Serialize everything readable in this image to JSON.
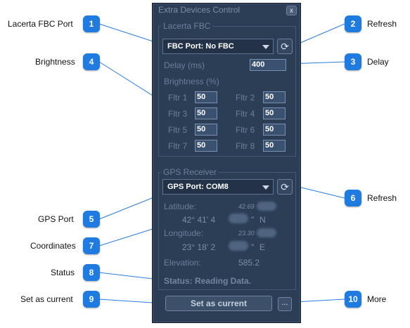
{
  "window": {
    "title": "Extra Devices Control",
    "close_label": "x"
  },
  "lacerta": {
    "group_title": "Lacerta FBC",
    "port_value": "FBC Port: No FBC",
    "delay_label": "Delay (ms)",
    "delay_value": "400",
    "brightness_label": "Brightness (%)",
    "filters": [
      {
        "label": "Fltr 1",
        "value": "50"
      },
      {
        "label": "Fltr 2",
        "value": "50"
      },
      {
        "label": "Fltr 3",
        "value": "50"
      },
      {
        "label": "Fltr 4",
        "value": "50"
      },
      {
        "label": "Fltr 5",
        "value": "50"
      },
      {
        "label": "Fltr 6",
        "value": "50"
      },
      {
        "label": "Fltr 7",
        "value": "50"
      },
      {
        "label": "Fltr 8",
        "value": "50"
      }
    ]
  },
  "gps": {
    "group_title": "GPS Receiver",
    "port_value": "GPS Port: COM8",
    "latitude_label": "Latitude:",
    "latitude_decimal": "42.69",
    "latitude_dms_deg": "42° 41' 4",
    "latitude_dms_sec_mark": "\"",
    "latitude_hemisphere": "N",
    "longitude_label": "Longitude:",
    "longitude_decimal": "23.30",
    "longitude_dms_deg": "23° 18' 2",
    "longitude_dms_sec_mark": "\"",
    "longitude_hemisphere": "E",
    "elevation_label": "Elevation:",
    "elevation_value": "585.2",
    "status_text": "Status: Reading Data."
  },
  "actions": {
    "set_current_label": "Set as current",
    "more_label": "..."
  },
  "callouts": [
    {
      "num": "1",
      "text": "Lacerta FBC Port"
    },
    {
      "num": "2",
      "text": "Refresh"
    },
    {
      "num": "3",
      "text": "Delay"
    },
    {
      "num": "4",
      "text": "Brightness"
    },
    {
      "num": "5",
      "text": "GPS Port"
    },
    {
      "num": "6",
      "text": "Refresh"
    },
    {
      "num": "7",
      "text": "Coordinates"
    },
    {
      "num": "8",
      "text": "Status"
    },
    {
      "num": "9",
      "text": "Set as current"
    },
    {
      "num": "10",
      "text": "More"
    }
  ],
  "colors": {
    "panel_bg": "#2c3e55",
    "callout_badge": "#1f7be0",
    "field_bg": "#3a5170"
  }
}
